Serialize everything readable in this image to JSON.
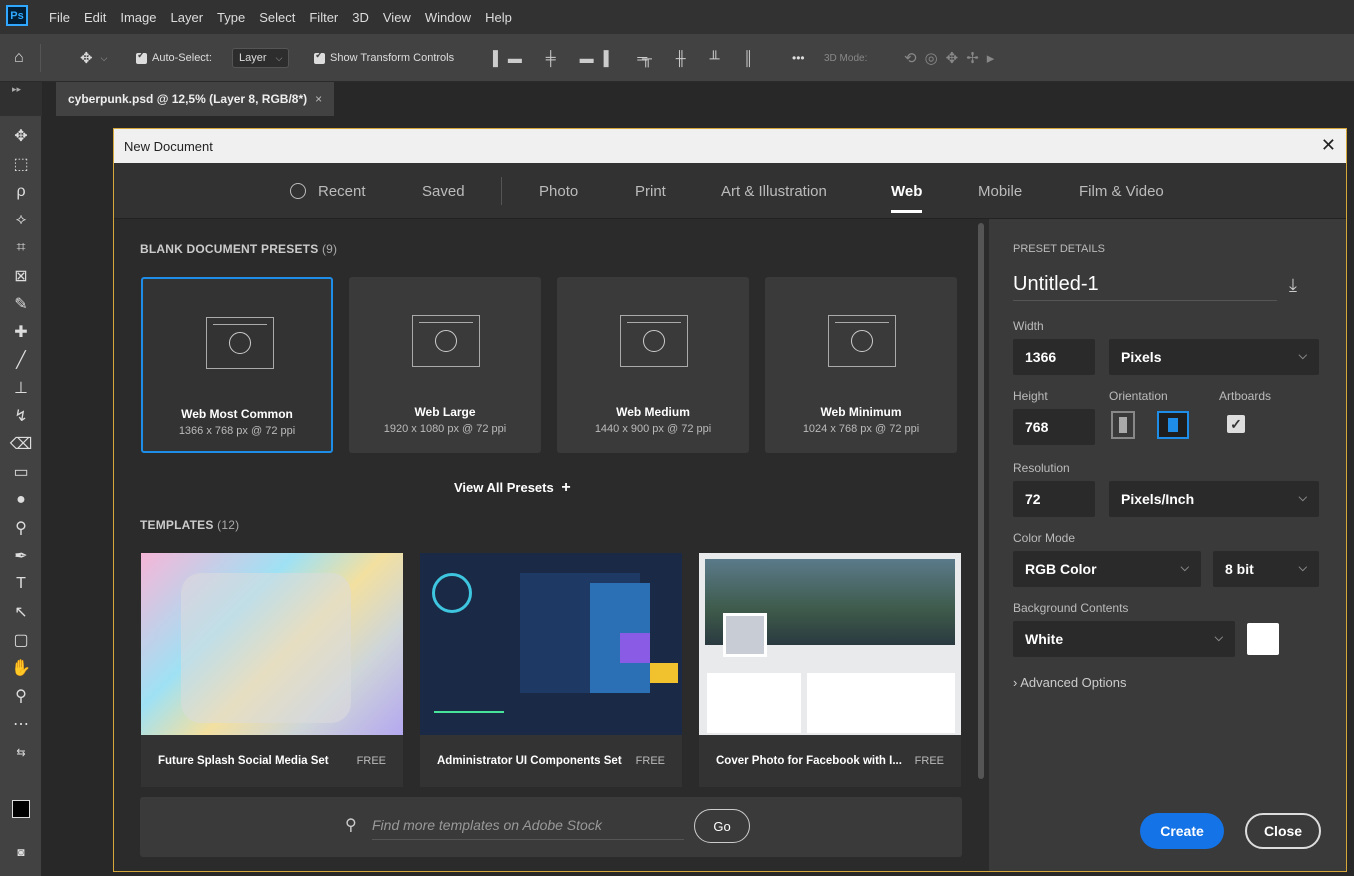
{
  "app": {
    "logo": "Ps"
  },
  "menu": [
    "File",
    "Edit",
    "Image",
    "Layer",
    "Type",
    "Select",
    "Filter",
    "3D",
    "View",
    "Window",
    "Help"
  ],
  "options": {
    "auto_select": "Auto-Select:",
    "layer_dropdown": "Layer",
    "show_transform": "Show Transform Controls",
    "more": "•••",
    "mode_3d": "3D Mode:"
  },
  "doc_tab": {
    "label": "cyberpunk.psd @ 12,5% (Layer 8, RGB/8*)",
    "close": "×"
  },
  "dialog": {
    "title": "New Document",
    "close": "✕",
    "tabs": [
      {
        "label": "Recent"
      },
      {
        "label": "Saved"
      },
      {
        "label": "Photo"
      },
      {
        "label": "Print"
      },
      {
        "label": "Art & Illustration"
      },
      {
        "label": "Web"
      },
      {
        "label": "Mobile"
      },
      {
        "label": "Film & Video"
      }
    ],
    "active_tab": "Web",
    "blank_presets": {
      "title": "BLANK DOCUMENT PRESETS",
      "count": "(9)"
    },
    "presets": [
      {
        "name": "Web Most Common",
        "desc": "1366 x 768 px @ 72 ppi"
      },
      {
        "name": "Web Large",
        "desc": "1920 x 1080 px @ 72 ppi"
      },
      {
        "name": "Web Medium",
        "desc": "1440 x 900 px @ 72 ppi"
      },
      {
        "name": "Web Minimum",
        "desc": "1024 x 768 px @ 72 ppi"
      }
    ],
    "view_all": "View All Presets",
    "view_all_plus": "+",
    "templates": {
      "title": "TEMPLATES",
      "count": "(12)"
    },
    "template_items": [
      {
        "name": "Future Splash Social Media Set",
        "tag": "FREE"
      },
      {
        "name": "Administrator UI Components Set",
        "tag": "FREE"
      },
      {
        "name": "Cover Photo for Facebook with I...",
        "tag": "FREE"
      }
    ],
    "stock_search": {
      "placeholder": "Find more templates on Adobe Stock",
      "go": "Go"
    },
    "details": {
      "title": "PRESET DETAILS",
      "name": "Untitled-1",
      "width_label": "Width",
      "width": "1366",
      "width_unit": "Pixels",
      "height_label": "Height",
      "height": "768",
      "orientation_label": "Orientation",
      "artboards_label": "Artboards",
      "resolution_label": "Resolution",
      "resolution": "72",
      "resolution_unit": "Pixels/Inch",
      "color_mode_label": "Color Mode",
      "color_mode": "RGB Color",
      "bit_depth": "8 bit",
      "bg_label": "Background Contents",
      "bg": "White",
      "advanced": "Advanced Options",
      "create": "Create",
      "close": "Close"
    }
  },
  "colors": {
    "accent": "#1473e6",
    "selected_border": "#1e8de8",
    "dialog_border": "#d6a83a"
  }
}
